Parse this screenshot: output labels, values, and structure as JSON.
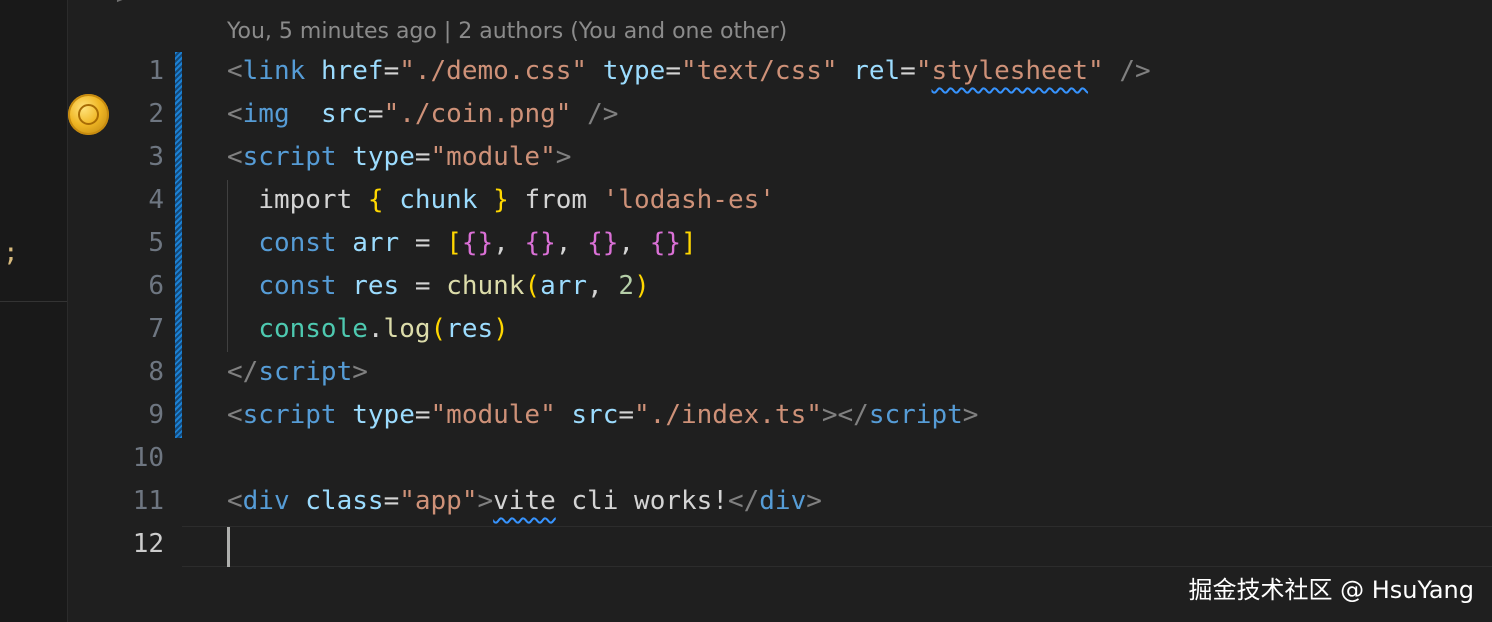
{
  "editor": {
    "left_pane_top_glyph": "- >",
    "left_pane_glyph": ";",
    "blame_annotation": "You, 5 minutes ago | 2 authors (You and one other)",
    "gutter_icon": "coin-icon",
    "active_line": "12",
    "line_numbers": [
      "1",
      "2",
      "3",
      "4",
      "5",
      "6",
      "7",
      "8",
      "9",
      "10",
      "11",
      "12"
    ],
    "lines": [
      [
        [
          "<",
          "#808080"
        ],
        [
          "link",
          "#569cd6"
        ],
        [
          " ",
          ""
        ],
        [
          "href",
          "#9cdcfe"
        ],
        [
          "=",
          "#d4d4d4"
        ],
        [
          "\"./demo.css\"",
          "#ce9178"
        ],
        [
          " ",
          ""
        ],
        [
          "type",
          "#9cdcfe"
        ],
        [
          "=",
          "#d4d4d4"
        ],
        [
          "\"text/css\"",
          "#ce9178"
        ],
        [
          " ",
          ""
        ],
        [
          "rel",
          "#9cdcfe"
        ],
        [
          "=",
          "#d4d4d4"
        ],
        [
          "\"",
          "#ce9178"
        ],
        [
          "stylesheet",
          "#ce9178",
          "squiggle"
        ],
        [
          "\"",
          "#ce9178"
        ],
        [
          " ",
          ""
        ],
        [
          "/>",
          "#808080"
        ]
      ],
      [
        [
          "<",
          "#808080"
        ],
        [
          "img",
          "#569cd6"
        ],
        [
          "  ",
          ""
        ],
        [
          "src",
          "#9cdcfe"
        ],
        [
          "=",
          "#d4d4d4"
        ],
        [
          "\"./coin.png\"",
          "#ce9178"
        ],
        [
          " ",
          ""
        ],
        [
          "/>",
          "#808080"
        ]
      ],
      [
        [
          "<",
          "#808080"
        ],
        [
          "script",
          "#569cd6"
        ],
        [
          " ",
          ""
        ],
        [
          "type",
          "#9cdcfe"
        ],
        [
          "=",
          "#d4d4d4"
        ],
        [
          "\"module\"",
          "#ce9178"
        ],
        [
          ">",
          "#808080"
        ]
      ],
      [
        [
          "  ",
          ""
        ],
        [
          "import",
          "#d4d4d4"
        ],
        [
          " ",
          ""
        ],
        [
          "{",
          "#ffd700"
        ],
        [
          " ",
          ""
        ],
        [
          "chunk",
          "#9cdcfe"
        ],
        [
          " ",
          ""
        ],
        [
          "}",
          "#ffd700"
        ],
        [
          " ",
          ""
        ],
        [
          "from",
          "#d4d4d4"
        ],
        [
          " ",
          ""
        ],
        [
          "'lodash-es'",
          "#ce9178"
        ]
      ],
      [
        [
          "  ",
          ""
        ],
        [
          "const",
          "#569cd6"
        ],
        [
          " ",
          ""
        ],
        [
          "arr",
          "#9cdcfe"
        ],
        [
          " = ",
          "#d4d4d4"
        ],
        [
          "[",
          "#ffd700"
        ],
        [
          "{}",
          "#da70d6"
        ],
        [
          ", ",
          "#d4d4d4"
        ],
        [
          "{}",
          "#da70d6"
        ],
        [
          ", ",
          "#d4d4d4"
        ],
        [
          "{}",
          "#da70d6"
        ],
        [
          ", ",
          "#d4d4d4"
        ],
        [
          "{}",
          "#da70d6"
        ],
        [
          "]",
          "#ffd700"
        ]
      ],
      [
        [
          "  ",
          ""
        ],
        [
          "const",
          "#569cd6"
        ],
        [
          " ",
          ""
        ],
        [
          "res",
          "#9cdcfe"
        ],
        [
          " = ",
          "#d4d4d4"
        ],
        [
          "chunk",
          "#dcdcaa"
        ],
        [
          "(",
          "#ffd700"
        ],
        [
          "arr",
          "#9cdcfe"
        ],
        [
          ", ",
          "#d4d4d4"
        ],
        [
          "2",
          "#b5cea8"
        ],
        [
          ")",
          "#ffd700"
        ]
      ],
      [
        [
          "  ",
          ""
        ],
        [
          "console",
          "#4ec9b0"
        ],
        [
          ".",
          "#d4d4d4"
        ],
        [
          "log",
          "#dcdcaa"
        ],
        [
          "(",
          "#ffd700"
        ],
        [
          "res",
          "#9cdcfe"
        ],
        [
          ")",
          "#ffd700"
        ]
      ],
      [
        [
          "</",
          "#808080"
        ],
        [
          "script",
          "#569cd6"
        ],
        [
          ">",
          "#808080"
        ]
      ],
      [
        [
          "<",
          "#808080"
        ],
        [
          "script",
          "#569cd6"
        ],
        [
          " ",
          ""
        ],
        [
          "type",
          "#9cdcfe"
        ],
        [
          "=",
          "#d4d4d4"
        ],
        [
          "\"module\"",
          "#ce9178"
        ],
        [
          " ",
          ""
        ],
        [
          "src",
          "#9cdcfe"
        ],
        [
          "=",
          "#d4d4d4"
        ],
        [
          "\"./index.ts\"",
          "#ce9178"
        ],
        [
          "></",
          "#808080"
        ],
        [
          "script",
          "#569cd6"
        ],
        [
          ">",
          "#808080"
        ]
      ],
      [],
      [
        [
          "<",
          "#808080"
        ],
        [
          "div",
          "#569cd6"
        ],
        [
          " ",
          ""
        ],
        [
          "class",
          "#9cdcfe"
        ],
        [
          "=",
          "#d4d4d4"
        ],
        [
          "\"app\"",
          "#ce9178"
        ],
        [
          ">",
          "#808080"
        ],
        [
          "vite",
          "#d4d4d4",
          "squiggle"
        ],
        [
          " cli works!",
          "#d4d4d4"
        ],
        [
          "</",
          "#808080"
        ],
        [
          "div",
          "#569cd6"
        ],
        [
          ">",
          "#808080"
        ]
      ],
      []
    ]
  },
  "watermark": "掘金技术社区 @ HsuYang"
}
